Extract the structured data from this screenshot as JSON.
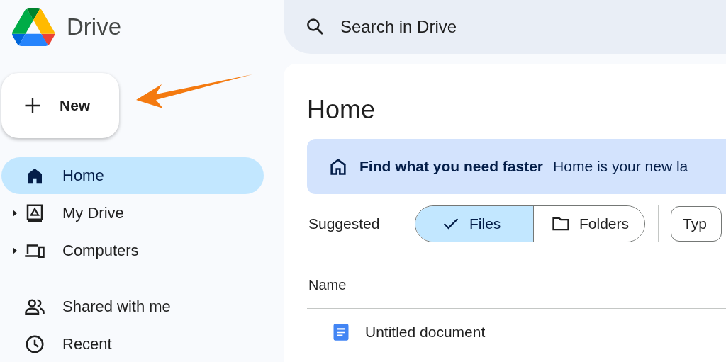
{
  "app": {
    "title": "Drive"
  },
  "search": {
    "placeholder": "Search in Drive"
  },
  "new_button": {
    "label": "New"
  },
  "annotation_arrow": {
    "color": "#f47a10"
  },
  "sidebar": {
    "items": [
      {
        "label": "Home",
        "selected": true,
        "expandable": false
      },
      {
        "label": "My Drive",
        "selected": false,
        "expandable": true
      },
      {
        "label": "Computers",
        "selected": false,
        "expandable": true
      },
      {
        "label": "Shared with me",
        "selected": false,
        "expandable": false
      },
      {
        "label": "Recent",
        "selected": false,
        "expandable": false
      }
    ]
  },
  "main": {
    "title": "Home",
    "banner": {
      "heading": "Find what you need faster",
      "text": "Home is your new la"
    },
    "filters": {
      "label": "Suggested",
      "segments": [
        {
          "label": "Files",
          "selected": true
        },
        {
          "label": "Folders",
          "selected": false
        }
      ],
      "chips": [
        "Typ"
      ]
    },
    "table": {
      "columns": [
        "Name"
      ],
      "rows": [
        {
          "name": "Untitled document"
        }
      ]
    }
  }
}
